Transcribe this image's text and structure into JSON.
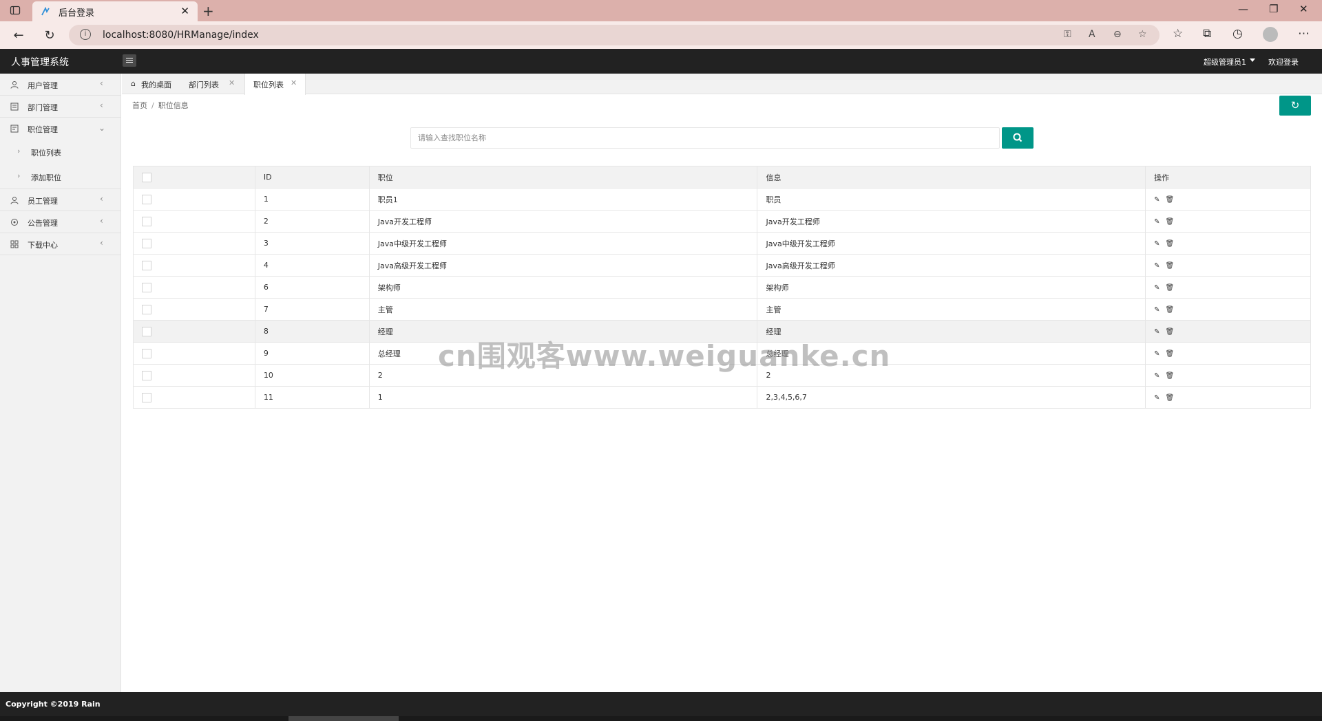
{
  "browser": {
    "tab_title": "后台登录",
    "url": "localhost:8080/HRManage/index"
  },
  "header": {
    "app_title": "人事管理系统",
    "admin_name": "超级管理员1",
    "welcome_label": "欢迎登录"
  },
  "sidebar": {
    "items": [
      {
        "label": "用户管理"
      },
      {
        "label": "部门管理"
      },
      {
        "label": "职位管理"
      },
      {
        "label": "员工管理"
      },
      {
        "label": "公告管理"
      },
      {
        "label": "下载中心"
      }
    ],
    "sub_items": [
      {
        "label": "职位列表"
      },
      {
        "label": "添加职位"
      }
    ]
  },
  "tabs": [
    {
      "label": "我的桌面"
    },
    {
      "label": "部门列表"
    },
    {
      "label": "职位列表"
    }
  ],
  "breadcrumb": {
    "home": "首页",
    "sep": "/",
    "current": "职位信息"
  },
  "search": {
    "placeholder": "请输入查找职位名称"
  },
  "table": {
    "headers": [
      "ID",
      "职位",
      "信息",
      "操作"
    ],
    "rows": [
      {
        "id": "1",
        "name": "职员1",
        "info": "职员"
      },
      {
        "id": "2",
        "name": "Java开发工程师",
        "info": "Java开发工程师"
      },
      {
        "id": "3",
        "name": "Java中级开发工程师",
        "info": "Java中级开发工程师"
      },
      {
        "id": "4",
        "name": "Java高级开发工程师",
        "info": "Java高级开发工程师"
      },
      {
        "id": "6",
        "name": "架构师",
        "info": "架构师"
      },
      {
        "id": "7",
        "name": "主管",
        "info": "主管"
      },
      {
        "id": "8",
        "name": "经理",
        "info": "经理"
      },
      {
        "id": "9",
        "name": "总经理",
        "info": "总经理"
      },
      {
        "id": "10",
        "name": "2",
        "info": "2"
      },
      {
        "id": "11",
        "name": "1",
        "info": "2,3,4,5,6,7"
      }
    ]
  },
  "watermark": "cn围观客www.weiguanke.cn",
  "footer": {
    "copyright": "Copyright ©2019 Rain"
  },
  "colors": {
    "accent": "#009688",
    "header_bg": "#222222",
    "browser_tab_bar": "#dcb0ab"
  },
  "icons": {
    "sidebar": [
      "user-icon",
      "department-icon",
      "position-icon",
      "employee-icon",
      "notice-icon",
      "download-icon"
    ],
    "row_actions": [
      "edit-icon",
      "delete-icon"
    ]
  }
}
